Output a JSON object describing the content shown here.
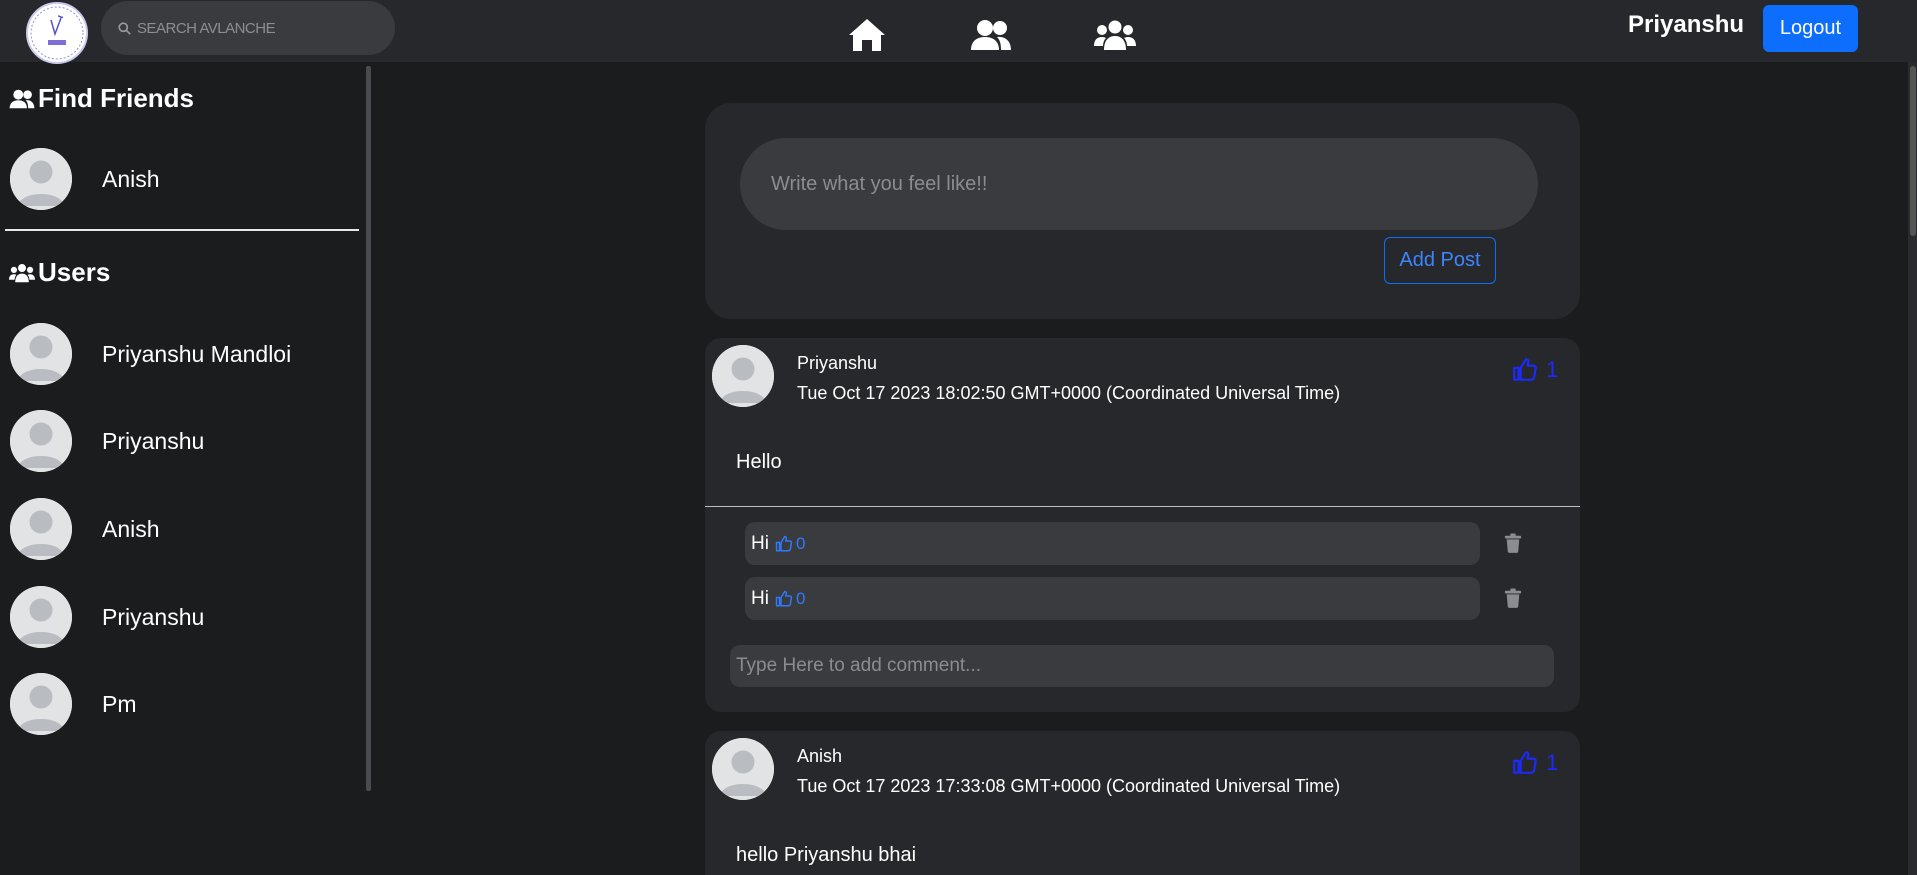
{
  "header": {
    "search_placeholder": "SEARCH AVLANCHE",
    "username": "Priyanshu",
    "logout_label": "Logout",
    "nav": [
      "home-icon",
      "friends-icon",
      "users-group-icon"
    ]
  },
  "sidebar": {
    "find_friends_title": "Find Friends",
    "friends": [
      {
        "name": "Anish"
      }
    ],
    "users_title": "Users",
    "users": [
      {
        "name": "Priyanshu Mandloi"
      },
      {
        "name": "Priyanshu"
      },
      {
        "name": "Anish"
      },
      {
        "name": "Priyanshu"
      },
      {
        "name": "Pm"
      }
    ]
  },
  "compose": {
    "placeholder": "Write what you feel like!!",
    "button_label": "Add Post"
  },
  "posts": [
    {
      "author": "Priyanshu",
      "time": "Tue Oct 17 2023 18:02:50 GMT+0000 (Coordinated Universal Time)",
      "likes": "1",
      "body": "Hello",
      "comments": [
        {
          "text": "Hi",
          "likes": "0"
        },
        {
          "text": "Hi",
          "likes": "0"
        }
      ],
      "comment_placeholder": "Type Here to add comment..."
    },
    {
      "author": "Anish",
      "time": "Tue Oct 17 2023 17:33:08 GMT+0000 (Coordinated Universal Time)",
      "likes": "1",
      "body": "hello Priyanshu bhai"
    }
  ],
  "colors": {
    "accent": "#0d6efd",
    "like": "#1b2bff",
    "background": "#1b1c1e",
    "card": "#27282b"
  }
}
